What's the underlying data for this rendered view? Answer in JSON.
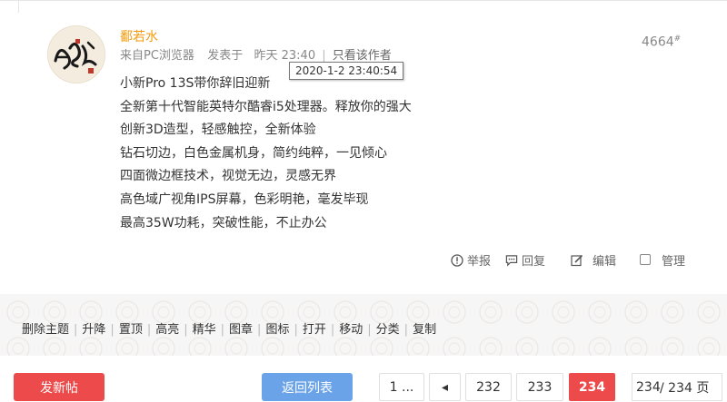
{
  "post": {
    "author": "鄱若水",
    "source": "来自PC浏览器",
    "posted_prefix": "发表于",
    "posted_time": "昨天 23:40",
    "only_author": "只看该作者",
    "floor_number": "4664",
    "floor_mark": "#",
    "tooltip_time": "2020-1-2 23:40:54",
    "content": [
      "小新Pro 13S带你辞旧迎新",
      "全新第十代智能英特尔酷睿i5处理器。释放你的强大",
      "创新3D造型，轻感触控，全新体验",
      "钻石切边，白色金属机身，简约纯粹，一见倾心",
      "四面微边框技术，视觉无边，灵感无界",
      "高色域广视角IPS屏幕，色彩明艳，毫发毕现",
      "最高35W功耗，突破性能，不止办公"
    ],
    "actions": {
      "report": "举报",
      "reply": "回复",
      "edit": "编辑",
      "manage": "管理"
    }
  },
  "admin_links": [
    "删除主题",
    "升降",
    "置顶",
    "高亮",
    "精华",
    "图章",
    "图标",
    "打开",
    "移动",
    "分类",
    "复制"
  ],
  "footer": {
    "new_post": "发新帖",
    "back_to_list": "返回列表",
    "pages": {
      "first": "1 ...",
      "prev_icon": "◂",
      "p1": "232",
      "p2": "233",
      "current": "234",
      "input_value": "234",
      "total": "/ 234 页"
    }
  },
  "colors": {
    "accent_red": "#ed4b4b",
    "author_orange": "#f39c12",
    "back_blue": "#6ba3e9"
  }
}
